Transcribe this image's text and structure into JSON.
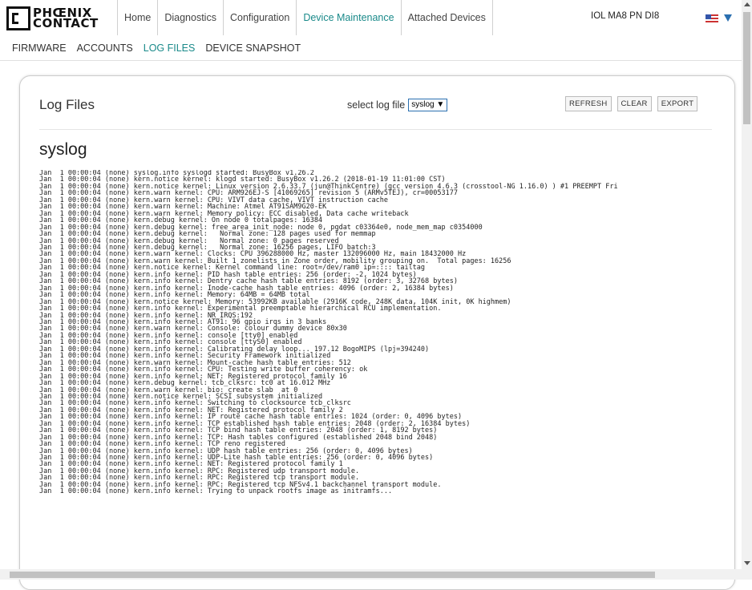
{
  "brand": {
    "line1": "PHŒNIX",
    "line2": "CONTACT"
  },
  "tabs": [
    "Home",
    "Diagnostics",
    "Configuration",
    "Device Maintenance",
    "Attached Devices"
  ],
  "device_name": "IOL MA8 PN DI8",
  "subtabs": [
    "FIRMWARE",
    "ACCOUNTS",
    "LOG FILES",
    "DEVICE SNAPSHOT"
  ],
  "panel": {
    "title": "Log Files",
    "select_label": "select log file",
    "select_value": "syslog",
    "buttons": {
      "refresh": "REFRESH",
      "clear": "CLEAR",
      "export": "EXPORT"
    },
    "log_name": "syslog"
  },
  "log_lines": [
    "Jan  1 00:00:04 (none) syslog.info syslogd started: BusyBox v1.26.2",
    "Jan  1 00:00:04 (none) kern.notice kernel: klogd started: BusyBox v1.26.2 (2018-01-19 11:01:00 CST)",
    "Jan  1 00:00:04 (none) kern.notice kernel: Linux version 2.6.33.7 (jun@ThinkCentre) (gcc version 4.6.3 (crosstool-NG 1.16.0) ) #1 PREEMPT Fri",
    "Jan  1 00:00:04 (none) kern.warn kernel: CPU: ARM926EJ-S [41069265] revision 5 (ARMv5TEJ), cr=00053177",
    "Jan  1 00:00:04 (none) kern.warn kernel: CPU: VIVT data cache, VIVT instruction cache",
    "Jan  1 00:00:04 (none) kern.warn kernel: Machine: Atmel AT91SAM9G20-EK",
    "Jan  1 00:00:04 (none) kern.warn kernel: Memory policy: ECC disabled, Data cache writeback",
    "Jan  1 00:00:04 (none) kern.debug kernel: On node 0 totalpages: 16384",
    "Jan  1 00:00:04 (none) kern.debug kernel: free_area_init_node: node 0, pgdat c03364e0, node_mem_map c0354000",
    "Jan  1 00:00:04 (none) kern.debug kernel:   Normal zone: 128 pages used for memmap",
    "Jan  1 00:00:04 (none) kern.debug kernel:   Normal zone: 0 pages reserved",
    "Jan  1 00:00:04 (none) kern.debug kernel:   Normal zone: 16256 pages, LIFO batch:3",
    "Jan  1 00:00:04 (none) kern.warn kernel: Clocks: CPU 396288000 Hz, master 132096000 Hz, main 18432000 Hz",
    "Jan  1 00:00:04 (none) kern.warn kernel: Built 1 zonelists in Zone order, mobility grouping on.  Total pages: 16256",
    "Jan  1 00:00:04 (none) kern.notice kernel: Kernel command line: root=/dev/ram0 ip=:::: tailtag",
    "Jan  1 00:00:04 (none) kern.info kernel: PID hash table entries: 256 (order: -2, 1024 bytes)",
    "Jan  1 00:00:04 (none) kern.info kernel: Dentry cache hash table entries: 8192 (order: 3, 32768 bytes)",
    "Jan  1 00:00:04 (none) kern.info kernel: Inode-cache hash table entries: 4096 (order: 2, 16384 bytes)",
    "Jan  1 00:00:04 (none) kern.info kernel: Memory: 64MB = 64MB total",
    "Jan  1 00:00:04 (none) kern.notice kernel: Memory: 53992KB available (2916K code, 248K data, 104K init, 0K highmem)",
    "Jan  1 00:00:04 (none) kern.info kernel: Experimental preemptable hierarchical RCU implementation.",
    "Jan  1 00:00:04 (none) kern.info kernel: NR_IRQS:192",
    "Jan  1 00:00:04 (none) kern.info kernel: AT91: 96 gpio irqs in 3 banks",
    "Jan  1 00:00:04 (none) kern.warn kernel: Console: colour dummy device 80x30",
    "Jan  1 00:00:04 (none) kern.info kernel: console [tty0] enabled",
    "Jan  1 00:00:04 (none) kern.info kernel: console [ttyS0] enabled",
    "Jan  1 00:00:04 (none) kern.info kernel: Calibrating delay loop... 197.12 BogoMIPS (lpj=394240)",
    "Jan  1 00:00:04 (none) kern.info kernel: Security Framework initialized",
    "Jan  1 00:00:04 (none) kern.warn kernel: Mount-cache hash table entries: 512",
    "Jan  1 00:00:04 (none) kern.info kernel: CPU: Testing write buffer coherency: ok",
    "Jan  1 00:00:04 (none) kern.info kernel: NET: Registered protocol family 16",
    "Jan  1 00:00:04 (none) kern.debug kernel: tcb_clksrc: tc0 at 16.012 MHz",
    "Jan  1 00:00:04 (none) kern.warn kernel: bio: create slab  at 0",
    "Jan  1 00:00:04 (none) kern.notice kernel: SCSI subsystem initialized",
    "Jan  1 00:00:04 (none) kern.info kernel: Switching to clocksource tcb_clksrc",
    "Jan  1 00:00:04 (none) kern.info kernel: NET: Registered protocol family 2",
    "Jan  1 00:00:04 (none) kern.info kernel: IP route cache hash table entries: 1024 (order: 0, 4096 bytes)",
    "Jan  1 00:00:04 (none) kern.info kernel: TCP established hash table entries: 2048 (order: 2, 16384 bytes)",
    "Jan  1 00:00:04 (none) kern.info kernel: TCP bind hash table entries: 2048 (order: 1, 8192 bytes)",
    "Jan  1 00:00:04 (none) kern.info kernel: TCP: Hash tables configured (established 2048 bind 2048)",
    "Jan  1 00:00:04 (none) kern.info kernel: TCP reno registered",
    "Jan  1 00:00:04 (none) kern.info kernel: UDP hash table entries: 256 (order: 0, 4096 bytes)",
    "Jan  1 00:00:04 (none) kern.info kernel: UDP-Lite hash table entries: 256 (order: 0, 4096 bytes)",
    "Jan  1 00:00:04 (none) kern.info kernel: NET: Registered protocol family 1",
    "Jan  1 00:00:04 (none) kern.info kernel: RPC: Registered udp transport module.",
    "Jan  1 00:00:04 (none) kern.info kernel: RPC: Registered tcp transport module.",
    "Jan  1 00:00:04 (none) kern.info kernel: RPC: Registered tcp NFSv4.1 backchannel transport module.",
    "Jan  1 00:00:04 (none) kern.info kernel: Trying to unpack rootfs image as initramfs..."
  ],
  "colors": {
    "accent": "#1a8a8a",
    "select_border": "#2a6fb0"
  }
}
